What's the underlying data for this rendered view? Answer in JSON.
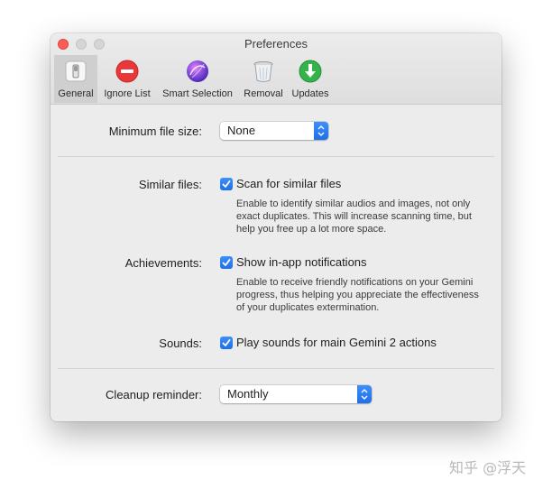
{
  "window": {
    "title": "Preferences"
  },
  "toolbar": {
    "tabs": [
      {
        "label": "General",
        "icon": "general-switch-icon",
        "active": true
      },
      {
        "label": "Ignore List",
        "icon": "no-entry-icon",
        "active": false
      },
      {
        "label": "Smart Selection",
        "icon": "purple-orb-icon",
        "active": false
      },
      {
        "label": "Removal",
        "icon": "trash-can-icon",
        "active": false
      },
      {
        "label": "Updates",
        "icon": "download-arrow-icon",
        "active": false
      }
    ]
  },
  "general": {
    "min_file_size": {
      "label": "Minimum file size:",
      "value": "None"
    },
    "similar_files": {
      "label": "Similar files:",
      "checkbox_label": "Scan for similar files",
      "checked": true,
      "description": "Enable to identify similar audios and images, not only exact duplicates. This will increase scanning time, but help you free up a lot more space."
    },
    "achievements": {
      "label": "Achievements:",
      "checkbox_label": "Show in-app notifications",
      "checked": true,
      "description": "Enable to receive friendly notifications on your Gemini progress, thus helping you appreciate the effectiveness of your duplicates extermination."
    },
    "sounds": {
      "label": "Sounds:",
      "checkbox_label": "Play sounds for main Gemini 2 actions",
      "checked": true
    },
    "cleanup_reminder": {
      "label": "Cleanup reminder:",
      "value": "Monthly"
    }
  },
  "watermark": "知乎 @浮天",
  "colors": {
    "accent": "#2a7ef0",
    "close": "#fd5c56",
    "window_bg": "#ececec"
  }
}
